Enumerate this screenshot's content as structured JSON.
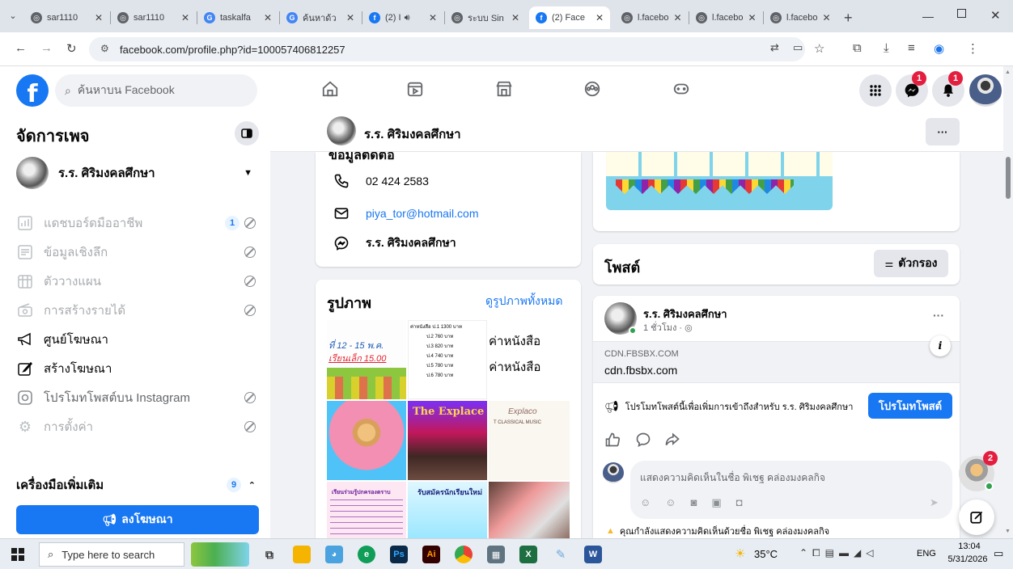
{
  "browser": {
    "tabs": [
      {
        "title": "sar1110",
        "color": "#5f6368"
      },
      {
        "title": "sar1110",
        "color": "#5f6368"
      },
      {
        "title": "taskalfa",
        "color": "#4285f4"
      },
      {
        "title": "ค้นหาด้ว",
        "color": "#4285f4"
      },
      {
        "title": "(2) I",
        "color": "#1877f2"
      },
      {
        "title": "ระบบ Sin",
        "color": "#5f6368"
      },
      {
        "title": "(2) Face",
        "color": "#1877f2"
      },
      {
        "title": "l.facebo",
        "color": "#5f6368"
      },
      {
        "title": "l.facebo",
        "color": "#5f6368"
      },
      {
        "title": "l.facebo",
        "color": "#5f6368"
      }
    ],
    "url": "facebook.com/profile.php?id=100057406812257"
  },
  "fb": {
    "search_placeholder": "ค้นหาบน Facebook",
    "messenger_badge": "1",
    "notif_badge": "1"
  },
  "sidebar": {
    "title": "จัดการเพจ",
    "page_name": "ร.ร. ศิริมงคลศึกษา",
    "items": [
      {
        "label": "แดชบอร์ดมืออาชีพ",
        "count": "1"
      },
      {
        "label": "ข้อมูลเชิงลึก"
      },
      {
        "label": "ตัววางแผน"
      },
      {
        "label": "การสร้างรายได้"
      },
      {
        "label": "ศูนย์โฆษณา"
      },
      {
        "label": "สร้างโฆษณา"
      },
      {
        "label": "โปรโมทโพสต์บน Instagram"
      },
      {
        "label": "การตั้งค่า"
      }
    ],
    "more_tools": "เครื่องมือเพิ่มเติม",
    "more_count": "9",
    "ad_button": "ลงโฆษณา"
  },
  "page_header": {
    "name": "ร.ร. ศิริมงคลศึกษา",
    "more": "···"
  },
  "contact": {
    "heading": "ข้อมูลติดต่อ",
    "phone": "02 424 2583",
    "email": "piya_tor@hotmail.com",
    "messenger": "ร.ร. ศิริมงคลศึกษา"
  },
  "photos": {
    "title": "รูปภาพ",
    "see_all": "ดูรูปภาพทั้งหมด",
    "thumb1_l1": "ที่ 12 - 15 พ.ค.",
    "thumb1_l2": "เรียนเล็ก 15.00",
    "thumb2_title": "ค่าหนังสือ",
    "thumb2_sub": "3 ค่าหนังสือ",
    "thumb2_rows": [
      "ค่าหนังสือ ป.1 1300 บาท",
      "ป.2 760 บาท",
      "ป.3 820 บาท",
      "ป.4 740 บาท",
      "ป.5 780 บาท",
      "ป.6 780 บาท"
    ],
    "thumb4": "The Explace",
    "thumb5": "Explaco",
    "thumb5_sub": "T CLASSICAL MUSIC",
    "thumb7": "เรียนร่วมรู้ปกครองตราบ",
    "thumb8": "รับสมัครนักเรียนใหม่"
  },
  "posts": {
    "heading": "โพสต์",
    "filter": "ตัวกรอง",
    "post": {
      "author": "ร.ร. ศิริมงคลศึกษา",
      "time": "1 ชั่วโมง · ",
      "more": "···",
      "link_domain": "CDN.FBSBX.COM",
      "link_title": "cdn.fbsbx.com",
      "promo_text": "โปรโมทโพสต์นี้เพื่อเพิ่มการเข้าถึงสำหรับ ร.ร. ศิริมงคลศึกษา",
      "promo_button": "โปรโมทโพสต์",
      "comment_placeholder": "แสดงความคิดเห็นในชื่อ พิเชฐ คล่องมงคลกิจ",
      "warning": "คุณกำลังแสดงความคิดเห็นด้วยชื่อ พิเชฐ คล่องมงคลกิจ"
    },
    "chat_badge": "2"
  },
  "taskbar": {
    "search": "Type here to search",
    "temp": "35°C",
    "lang": "ENG",
    "time": "13:04",
    "date": "5/31/2026"
  }
}
